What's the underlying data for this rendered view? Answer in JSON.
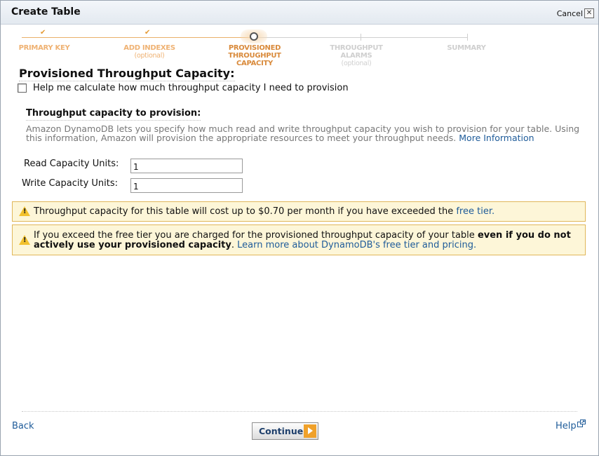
{
  "dialog": {
    "title": "Create Table",
    "cancel_label": "Cancel",
    "close_glyph": "✕"
  },
  "wizard": {
    "steps": [
      {
        "label": "PRIMARY KEY",
        "optional": "",
        "state": "done",
        "check": "✔"
      },
      {
        "label": "ADD INDEXES",
        "optional": "(optional)",
        "state": "done",
        "check": "✔"
      },
      {
        "label": "PROVISIONED",
        "label2": "THROUGHPUT CAPACITY",
        "optional": "",
        "state": "active"
      },
      {
        "label": "THROUGHPUT ALARMS",
        "optional": "(optional)",
        "state": "todo"
      },
      {
        "label": "SUMMARY",
        "optional": "",
        "state": "todo"
      }
    ]
  },
  "main": {
    "heading": "Provisioned Throughput Capacity:",
    "help_checkbox_label": "Help me calculate how much throughput capacity I need to provision",
    "subheading": "Throughput capacity to provision:",
    "description": "Amazon DynamoDB lets you specify how much read and write throughput capacity you wish to provision for your table. Using this information, Amazon will provision the appropriate resources to meet your throughput needs.",
    "more_info_link": "More Information",
    "read_label": "Read Capacity Units:",
    "read_value": "1",
    "write_label": "Write Capacity Units:",
    "write_value": "1"
  },
  "alerts": {
    "cost_text": "Throughput capacity for this table will cost up to $0.70 per month if you have exceeded the",
    "free_tier_link": "free tier.",
    "charge_text": "If you exceed the free tier you are charged for the provisioned throughput capacity of your table",
    "charge_bold": "even if you do not actively use your provisioned capacity",
    "charge_period": ".",
    "learn_more_link": "Learn more about DynamoDB's free tier and pricing."
  },
  "footer": {
    "back_label": "Back",
    "continue_label": "Continue",
    "help_label": "Help"
  },
  "colors": {
    "accent_orange": "#f0a12a",
    "link_blue": "#1e5b99",
    "alert_bg": "#fdf6d8",
    "alert_border": "#e0b75a"
  }
}
